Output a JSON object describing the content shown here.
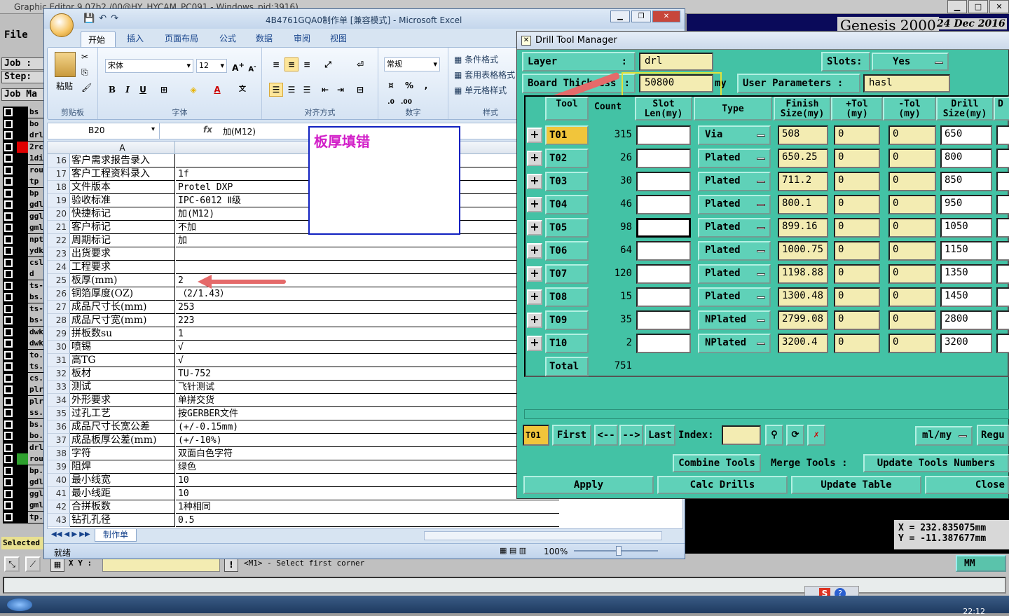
{
  "genesis": {
    "title": "Graphic Editor 9.07b2 /00@HY_HYCAM_PC091 - Windows_pid:3916)",
    "menu_file": "File",
    "job_label": "Job :",
    "step_label": "Step:",
    "job_mgr_label": "Job Ma",
    "logo": "Genesis 2000",
    "date": "24 Dec 2016",
    "coord_x": "X = 232.835075mm",
    "coord_y": "Y = -11.387677mm",
    "xy_label": "X Y :",
    "message": "<M1> - Select first corner",
    "units": "MM",
    "selected": "Selected",
    "clock": "22:12",
    "layers": [
      {
        "name": "bs",
        "color": "#000"
      },
      {
        "name": "bo",
        "color": "#000"
      },
      {
        "name": "drl",
        "color": "#000"
      },
      {
        "name": "2rc",
        "color": "#e00000"
      },
      {
        "name": "1di",
        "color": "#000"
      },
      {
        "name": "rou",
        "color": "#000"
      },
      {
        "name": "tp",
        "color": "#000"
      },
      {
        "name": "bp",
        "color": "#000"
      },
      {
        "name": "gdl",
        "color": "#000"
      },
      {
        "name": "ggl",
        "color": "#000"
      },
      {
        "name": "gml",
        "color": "#000"
      },
      {
        "name": "npt",
        "color": "#000"
      },
      {
        "name": "ydk",
        "color": "#000"
      },
      {
        "name": "csl",
        "color": "#000"
      },
      {
        "name": "d",
        "color": "#000"
      },
      {
        "name": "ts-",
        "color": "#000"
      },
      {
        "name": "bs.",
        "color": "#000"
      },
      {
        "name": "ts-",
        "color": "#000"
      },
      {
        "name": "bs-",
        "color": "#000"
      },
      {
        "name": "dwk",
        "color": "#000"
      },
      {
        "name": "dwk",
        "color": "#000"
      },
      {
        "name": "to.",
        "color": "#000"
      },
      {
        "name": "ts.",
        "color": "#000"
      },
      {
        "name": "cs.",
        "color": "#000"
      },
      {
        "name": "plr",
        "color": "#000"
      },
      {
        "name": "plr",
        "color": "#000"
      },
      {
        "name": "ss.",
        "color": "#000"
      },
      {
        "name": "bs.",
        "color": "#000"
      },
      {
        "name": "bo.",
        "color": "#000"
      },
      {
        "name": "drl",
        "color": "#000"
      },
      {
        "name": "rou",
        "color": "#2ea02e"
      },
      {
        "name": "bp.",
        "color": "#000"
      },
      {
        "name": "gdl",
        "color": "#000"
      },
      {
        "name": "ggl",
        "color": "#000"
      },
      {
        "name": "gml",
        "color": "#000"
      },
      {
        "name": "tp.",
        "color": "#000"
      }
    ]
  },
  "excel": {
    "title": "4B4761GQA0制作单 [兼容模式] - Microsoft Excel",
    "tabs": [
      "开始",
      "插入",
      "页面布局",
      "公式",
      "数据",
      "审阅",
      "视图"
    ],
    "ribbon": {
      "paste": "粘贴",
      "clipboard": "剪贴板",
      "font_name": "宋体",
      "font_size": "12",
      "font_group": "字体",
      "align_group": "对齐方式",
      "number_format": "常规",
      "number_group": "数字",
      "cond_format": "条件格式",
      "table_format": "套用表格格式",
      "cell_style": "单元格样式",
      "style_group": "样式"
    },
    "name_box": "B20",
    "formula": "加(M12)",
    "col_a": "A",
    "rows": [
      {
        "n": "16",
        "a": "客户需求报告录入",
        "b": ""
      },
      {
        "n": "17",
        "a": "客户工程资料录入",
        "b": "1f"
      },
      {
        "n": "18",
        "a": "文件版本",
        "b": "Protel DXP"
      },
      {
        "n": "19",
        "a": "验收标准",
        "b": "IPC-6012 Ⅱ级"
      },
      {
        "n": "20",
        "a": "快捷标记",
        "b": "加(M12)"
      },
      {
        "n": "21",
        "a": "客户标记",
        "b": "不加"
      },
      {
        "n": "22",
        "a": "周期标记",
        "b": "加"
      },
      {
        "n": "23",
        "a": "出货要求",
        "b": ""
      },
      {
        "n": "24",
        "a": "工程要求",
        "b": ""
      },
      {
        "n": "25",
        "a": "板厚(mm)",
        "b": "2"
      },
      {
        "n": "26",
        "a": "铜箔厚度(OZ)",
        "b": "（2/1.43）"
      },
      {
        "n": "27",
        "a": "成品尺寸长(mm)",
        "b": "253"
      },
      {
        "n": "28",
        "a": "成品尺寸宽(mm)",
        "b": "223"
      },
      {
        "n": "29",
        "a": "拼板数su",
        "b": "1"
      },
      {
        "n": "30",
        "a": "喷锡",
        "b": "√"
      },
      {
        "n": "31",
        "a": "高TG",
        "b": "√"
      },
      {
        "n": "32",
        "a": "板材",
        "b": "TU-752"
      },
      {
        "n": "33",
        "a": "测试",
        "b": "飞针测试"
      },
      {
        "n": "34",
        "a": "外形要求",
        "b": "单拼交货"
      },
      {
        "n": "35",
        "a": "过孔工艺",
        "b": "按GERBER文件"
      },
      {
        "n": "36",
        "a": "成品尺寸长宽公差",
        "b": "(+/-0.15mm)"
      },
      {
        "n": "37",
        "a": "成品板厚公差(mm)",
        "b": "(+/-10%)"
      },
      {
        "n": "38",
        "a": "字符",
        "b": "双面白色字符"
      },
      {
        "n": "39",
        "a": "阻焊",
        "b": "绿色"
      },
      {
        "n": "40",
        "a": "最小线宽",
        "b": "10"
      },
      {
        "n": "41",
        "a": "最小线距",
        "b": "10"
      },
      {
        "n": "42",
        "a": "合拼板数",
        "b": "1种相同"
      },
      {
        "n": "43",
        "a": "钻孔孔径",
        "b": "0.5"
      }
    ],
    "annotation": "板厚填错",
    "sheet_tab": "制作单",
    "status": "就绪",
    "zoom": "100%"
  },
  "dtm": {
    "title": "Drill Tool Manager",
    "layer_label": "Layer",
    "layer_colon": ":",
    "layer_value": "drl",
    "slots_label": "Slots:",
    "slots_value": "Yes",
    "board_thickness_label": "Board Thickness",
    "bt_colon": ":",
    "board_thickness_value": "50800",
    "bt_unit": "my",
    "user_params_label": "User Parameters :",
    "user_params_value": "hasl",
    "headers": {
      "tool": "Tool",
      "count": "Count",
      "slot": "Slot\nLen(my)",
      "type": "Type",
      "finish": "Finish\nSize(my)",
      "ptol": "+Tol\n(my)",
      "ntol": "-Tol\n(my)",
      "drill": "Drill\nSize(my)",
      "extra": "D"
    },
    "tools": [
      {
        "tool": "T01",
        "count": "315",
        "type": "Via",
        "finish": "508",
        "ptol": "0",
        "ntol": "0",
        "drill": "650"
      },
      {
        "tool": "T02",
        "count": "26",
        "type": "Plated",
        "finish": "650.25",
        "ptol": "0",
        "ntol": "0",
        "drill": "800"
      },
      {
        "tool": "T03",
        "count": "30",
        "type": "Plated",
        "finish": "711.2",
        "ptol": "0",
        "ntol": "0",
        "drill": "850"
      },
      {
        "tool": "T04",
        "count": "46",
        "type": "Plated",
        "finish": "800.1",
        "ptol": "0",
        "ntol": "0",
        "drill": "950"
      },
      {
        "tool": "T05",
        "count": "98",
        "type": "Plated",
        "finish": "899.16",
        "ptol": "0",
        "ntol": "0",
        "drill": "1050"
      },
      {
        "tool": "T06",
        "count": "64",
        "type": "Plated",
        "finish": "1000.75",
        "ptol": "0",
        "ntol": "0",
        "drill": "1150"
      },
      {
        "tool": "T07",
        "count": "120",
        "type": "Plated",
        "finish": "1198.88",
        "ptol": "0",
        "ntol": "0",
        "drill": "1350"
      },
      {
        "tool": "T08",
        "count": "15",
        "type": "Plated",
        "finish": "1300.48",
        "ptol": "0",
        "ntol": "0",
        "drill": "1450"
      },
      {
        "tool": "T09",
        "count": "35",
        "type": "NPlated",
        "finish": "2799.08",
        "ptol": "0",
        "ntol": "0",
        "drill": "2800"
      },
      {
        "tool": "T10",
        "count": "2",
        "type": "NPlated",
        "finish": "3200.4",
        "ptol": "0",
        "ntol": "0",
        "drill": "3200"
      }
    ],
    "total_label": "Total",
    "total_value": "751",
    "current_tool": "T01",
    "nav": {
      "first": "First",
      "prev": "<--",
      "next": "-->",
      "last": "Last",
      "index": "Index:"
    },
    "units_sel": "ml/my",
    "regu": "Regu",
    "combine": "Combine Tools",
    "merge": "Merge Tools :",
    "update_numbers": "Update Tools Numbers",
    "apply": "Apply",
    "calc": "Calc Drills",
    "update_table": "Update Table",
    "close": "Close"
  }
}
